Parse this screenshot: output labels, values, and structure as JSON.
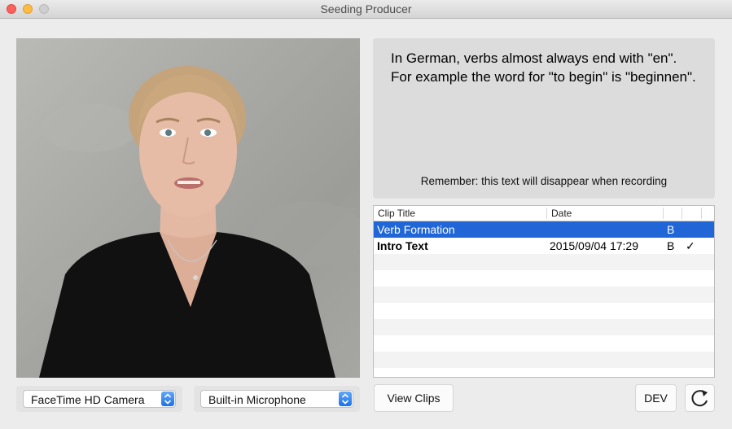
{
  "window": {
    "title": "Seeding Producer"
  },
  "video": {
    "alt": "camera preview"
  },
  "camera_popup": {
    "value": "FaceTime HD Camera"
  },
  "mic_popup": {
    "value": "Built-in Microphone"
  },
  "prompt": {
    "text": "In German, verbs almost always end with \"en\".  For example the word for \"to begin\" is \"beginnen\".",
    "note": "Remember: this text will disappear when recording"
  },
  "clips": {
    "headers": {
      "title": "Clip Title",
      "date": "Date"
    },
    "rows": [
      {
        "title": "Verb Formation",
        "date": "",
        "b": "B",
        "check": "",
        "selected": true
      },
      {
        "title": "Intro Text",
        "date": "2015/09/04 17:29",
        "b": "B",
        "check": "✓",
        "selected": false
      }
    ]
  },
  "buttons": {
    "view_clips": "View Clips",
    "dev": "DEV"
  },
  "icons": {
    "refresh": "refresh-icon",
    "stepper": "chevron-updown-icon"
  },
  "colors": {
    "selection": "#2066d7",
    "accent": "#1f71e6"
  }
}
